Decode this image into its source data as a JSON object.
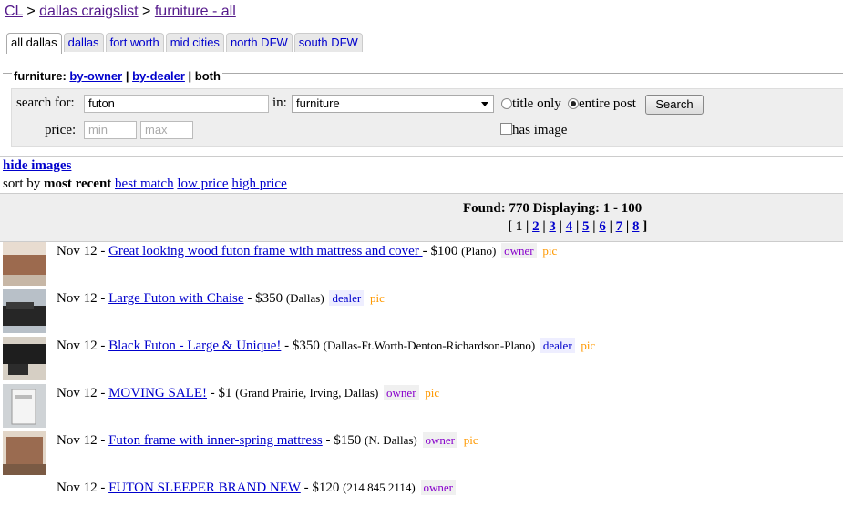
{
  "breadcrumb": {
    "cl": "CL",
    "sep1": ">",
    "city": "dallas craigslist",
    "sep2": ">",
    "category": "furniture - all"
  },
  "tabs": [
    "all dallas",
    "dallas",
    "fort worth",
    "mid cities",
    "north DFW",
    "south DFW"
  ],
  "filter": {
    "label": "furniture:",
    "by_owner": "by-owner",
    "sep1": "|",
    "by_dealer": "by-dealer",
    "sep2": "|",
    "both": "both"
  },
  "search": {
    "search_for_label": "search for:",
    "query": "futon",
    "in_label": "in:",
    "category": "furniture",
    "title_only": "title only",
    "entire_post": "entire post",
    "button": "Search",
    "has_image": "has image",
    "price_label": "price:",
    "min_placeholder": "min",
    "max_placeholder": "max"
  },
  "hide_images": "hide images",
  "sort": {
    "label": "sort by",
    "current": "most recent",
    "best_match": "best match",
    "low_price": "low price",
    "high_price": "high price"
  },
  "found": "Found: 770 Displaying: 1 - 100",
  "pager": {
    "open": "[",
    "current": "1",
    "pages": [
      "2",
      "3",
      "4",
      "5",
      "6",
      "7",
      "8"
    ],
    "close": "]"
  },
  "listings": [
    {
      "date": "Nov 12",
      "title": "Great looking wood futon frame with mattress and cover ",
      "price": "$100",
      "location": "(Plano)",
      "tag": "owner",
      "pic": "pic"
    },
    {
      "date": "Nov 12",
      "title": "Large Futon with Chaise",
      "price": "$350",
      "location": "(Dallas)",
      "tag": "dealer",
      "pic": "pic"
    },
    {
      "date": "Nov 12",
      "title": "Black Futon - Large & Unique!",
      "price": "$350",
      "location": "(Dallas-Ft.Worth-Denton-Richardson-Plano)",
      "tag": "dealer",
      "pic": "pic"
    },
    {
      "date": "Nov 12",
      "title": "MOVING SALE!",
      "price": "$1",
      "location": "(Grand Prairie, Irving, Dallas)",
      "tag": "owner",
      "pic": "pic"
    },
    {
      "date": "Nov 12",
      "title": "Futon frame with inner-spring mattress",
      "price": "$150",
      "location": "(N. Dallas)",
      "tag": "owner",
      "pic": "pic"
    },
    {
      "date": "Nov 12",
      "title": "FUTON SLEEPER BRAND NEW",
      "price": "$120",
      "location": "(214 845 2114)",
      "tag": "owner",
      "pic": ""
    }
  ]
}
